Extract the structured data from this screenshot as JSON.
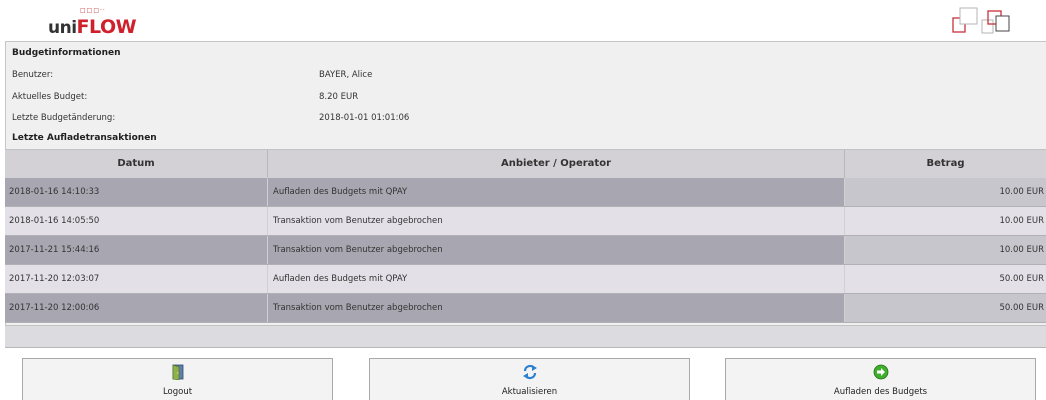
{
  "brand": {
    "logo_prefix": "uni",
    "logo_suffix": "FLOW",
    "logo_dots": "□□□··"
  },
  "budget_info": {
    "title": "Budgetinformationen",
    "user_label": "Benutzer:",
    "user_value": "BAYER, Alice",
    "budget_label": "Aktuelles Budget:",
    "budget_value": "8.20 EUR",
    "last_change_label": "Letzte Budgetänderung:",
    "last_change_value": "2018-01-01 01:01:06"
  },
  "transactions": {
    "title": "Letzte Aufladetransaktionen",
    "headers": {
      "date": "Datum",
      "operator": "Anbieter / Operator",
      "amount": "Betrag"
    },
    "rows": [
      {
        "date": "2018-01-16 14:10:33",
        "operator": "Aufladen des Budgets mit QPAY",
        "amount": "10.00 EUR"
      },
      {
        "date": "2018-01-16 14:05:50",
        "operator": "Transaktion vom Benutzer abgebrochen",
        "amount": "10.00 EUR"
      },
      {
        "date": "2017-11-21 15:44:16",
        "operator": "Transaktion vom Benutzer abgebrochen",
        "amount": "10.00 EUR"
      },
      {
        "date": "2017-11-20 12:03:07",
        "operator": "Aufladen des Budgets mit QPAY",
        "amount": "50.00 EUR"
      },
      {
        "date": "2017-11-20 12:00:06",
        "operator": "Transaktion vom Benutzer abgebrochen",
        "amount": "50.00 EUR"
      }
    ]
  },
  "buttons": {
    "logout": {
      "label": "Logout",
      "icon": "door-exit-icon"
    },
    "refresh": {
      "label": "Aktualisieren",
      "icon": "refresh-arrows-icon"
    },
    "topup": {
      "label": "Aufladen des Budgets",
      "icon": "green-arrow-right-icon"
    }
  },
  "colors": {
    "brand_red": "#d0202b",
    "row_dark": "#a8a6b0",
    "row_light": "#e3e1e7",
    "header": "#d3d1d6"
  }
}
